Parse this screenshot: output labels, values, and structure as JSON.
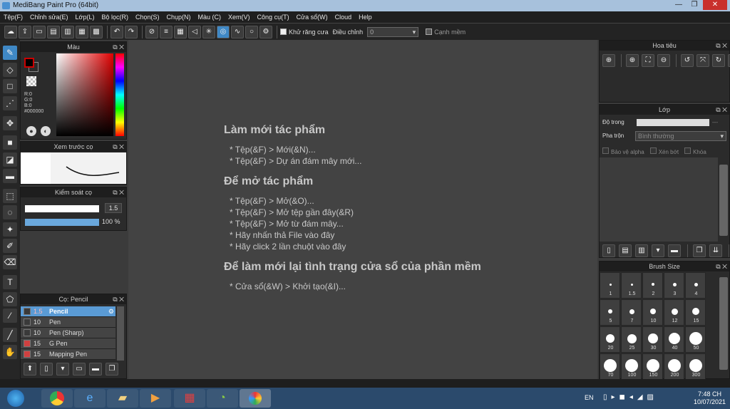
{
  "window": {
    "title": "MediBang Paint Pro (64bit)"
  },
  "menu": [
    "Tệp(F)",
    "Chỉnh sửa(E)",
    "Lớp(L)",
    "Bộ lọc(R)",
    "Chọn(S)",
    "Chụp(N)",
    "Màu (C)",
    "Xem(V)",
    "Công cụ(T)",
    "Cửa sổ(W)",
    "Cloud",
    "Help"
  ],
  "toolbar": {
    "antialias_label": "Khử răng cưa",
    "adjust_label": "Điều chỉnh",
    "adjust_value": "0",
    "edge_label": "Cạnh mềm"
  },
  "color_panel": {
    "title": "Màu",
    "r": "R:0",
    "g": "G:0",
    "b": "B:0",
    "hex": "#000000",
    "primary_color": "#cc0000",
    "secondary_color": "#ffffff"
  },
  "preview_panel": {
    "title": "Xem trước cọ"
  },
  "brush_control": {
    "title": "Kiểm soát cọ",
    "size": "1.5",
    "opacity": "100 %",
    "opacity_fraction": 1.0
  },
  "brush_list": {
    "title": "Cọ: Pencil",
    "items": [
      {
        "size": "1.5",
        "name": "Pencil",
        "selected": true,
        "color": "#3a3a3a"
      },
      {
        "size": "10",
        "name": "Pen",
        "selected": false,
        "color": "#3a3a3a"
      },
      {
        "size": "10",
        "name": "Pen (Sharp)",
        "selected": false,
        "color": "#3a3a3a"
      },
      {
        "size": "15",
        "name": "G Pen",
        "selected": false,
        "color": "#d04040"
      },
      {
        "size": "15",
        "name": "Mapping Pen",
        "selected": false,
        "color": "#d04040"
      }
    ]
  },
  "welcome": {
    "new_title": "Làm mới tác phẩm",
    "new_items": [
      "* Tệp(&F) > Mới(&N)...",
      "* Tệp(&F) > Dự án đám mây mới..."
    ],
    "open_title": "Để mở tác phẩm",
    "open_items": [
      "* Tệp(&F) > Mở(&O)...",
      "* Tệp(&F) > Mở tệp gần đây(&R)",
      "* Tệp(&F) > Mở từ đám mây...",
      "* Hãy nhấn thả File vào đây",
      "* Hãy click 2 lần chuột vào đây"
    ],
    "reset_title": "Để làm mới lại tình trạng cửa sổ của phần mềm",
    "reset_items": [
      "* Cửa sổ(&W) > Khởi tạo(&I)..."
    ]
  },
  "navigator": {
    "title": "Hoa tiêu"
  },
  "layer_panel": {
    "title": "Lớp",
    "opacity_label": "Độ trong",
    "opacity_value": "---",
    "blend_label": "Pha trộn",
    "blend_value": "Bình thường",
    "protect_alpha": "Bảo vệ alpha",
    "clipping": "Xén bớt",
    "lock": "Khóa"
  },
  "brush_size_panel": {
    "title": "Brush Size",
    "sizes": [
      "1",
      "1.5",
      "2",
      "3",
      "4",
      "5",
      "7",
      "10",
      "12",
      "15",
      "20",
      "25",
      "30",
      "40",
      "50",
      "70",
      "100",
      "150",
      "200",
      "300"
    ]
  },
  "taskbar": {
    "lang": "EN",
    "time": "7:48 CH",
    "date": "10/07/2021"
  }
}
